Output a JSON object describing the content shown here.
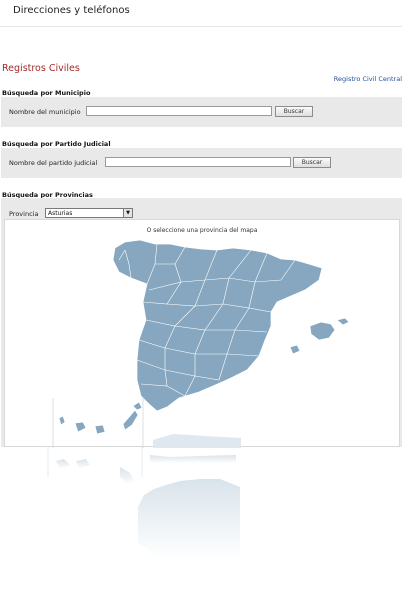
{
  "page": {
    "title": "Direcciones y teléfonos"
  },
  "section": {
    "title": "Registros Civiles",
    "central_link": "Registro Civil Central"
  },
  "municipio": {
    "heading": "Búsqueda por Municipio",
    "label": "Nombre del municipio",
    "value": "",
    "button": "Buscar"
  },
  "partido": {
    "heading": "Búsqueda por Partido Judicial",
    "label": "Nombre del partido judicial",
    "value": "",
    "button": "Buscar"
  },
  "provincias": {
    "heading": "Búsqueda por Provincias",
    "label": "Provincia",
    "selected": "Asturias",
    "map_hint": "O seleccione una provincia del mapa"
  },
  "colors": {
    "map_fill": "#86a7bf",
    "section_title": "#a52a2a",
    "link": "#1f4e9a"
  },
  "icons": {
    "select_arrow": "chevron-down-icon"
  }
}
